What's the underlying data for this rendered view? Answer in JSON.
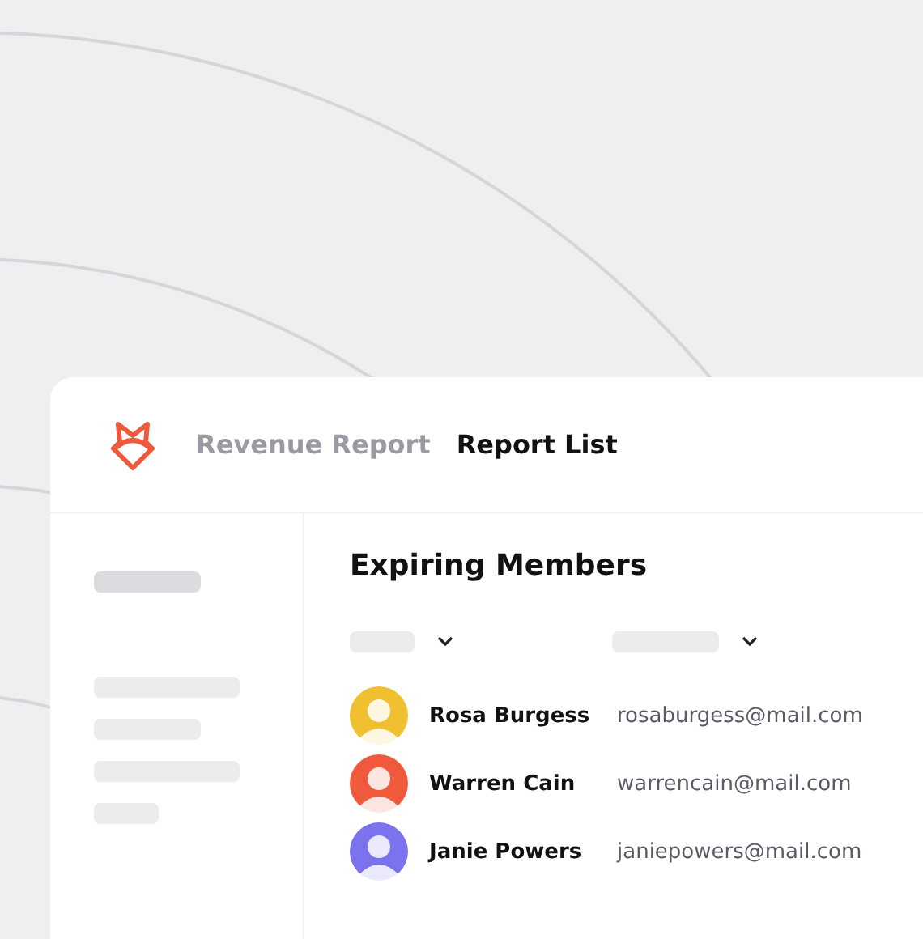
{
  "tabs": [
    {
      "label": "Revenue Report",
      "selected": false
    },
    {
      "label": "Report List",
      "selected": true
    }
  ],
  "panel": {
    "title": "Expiring Members"
  },
  "members": [
    {
      "name": "Rosa Burgess",
      "email": "rosaburgess@mail.com",
      "color": "#f0c030"
    },
    {
      "name": "Warren Cain",
      "email": "warrencain@mail.com",
      "color": "#ef5a3c"
    },
    {
      "name": "Janie Powers",
      "email": "janiepowers@mail.com",
      "color": "#7b73ee"
    }
  ]
}
